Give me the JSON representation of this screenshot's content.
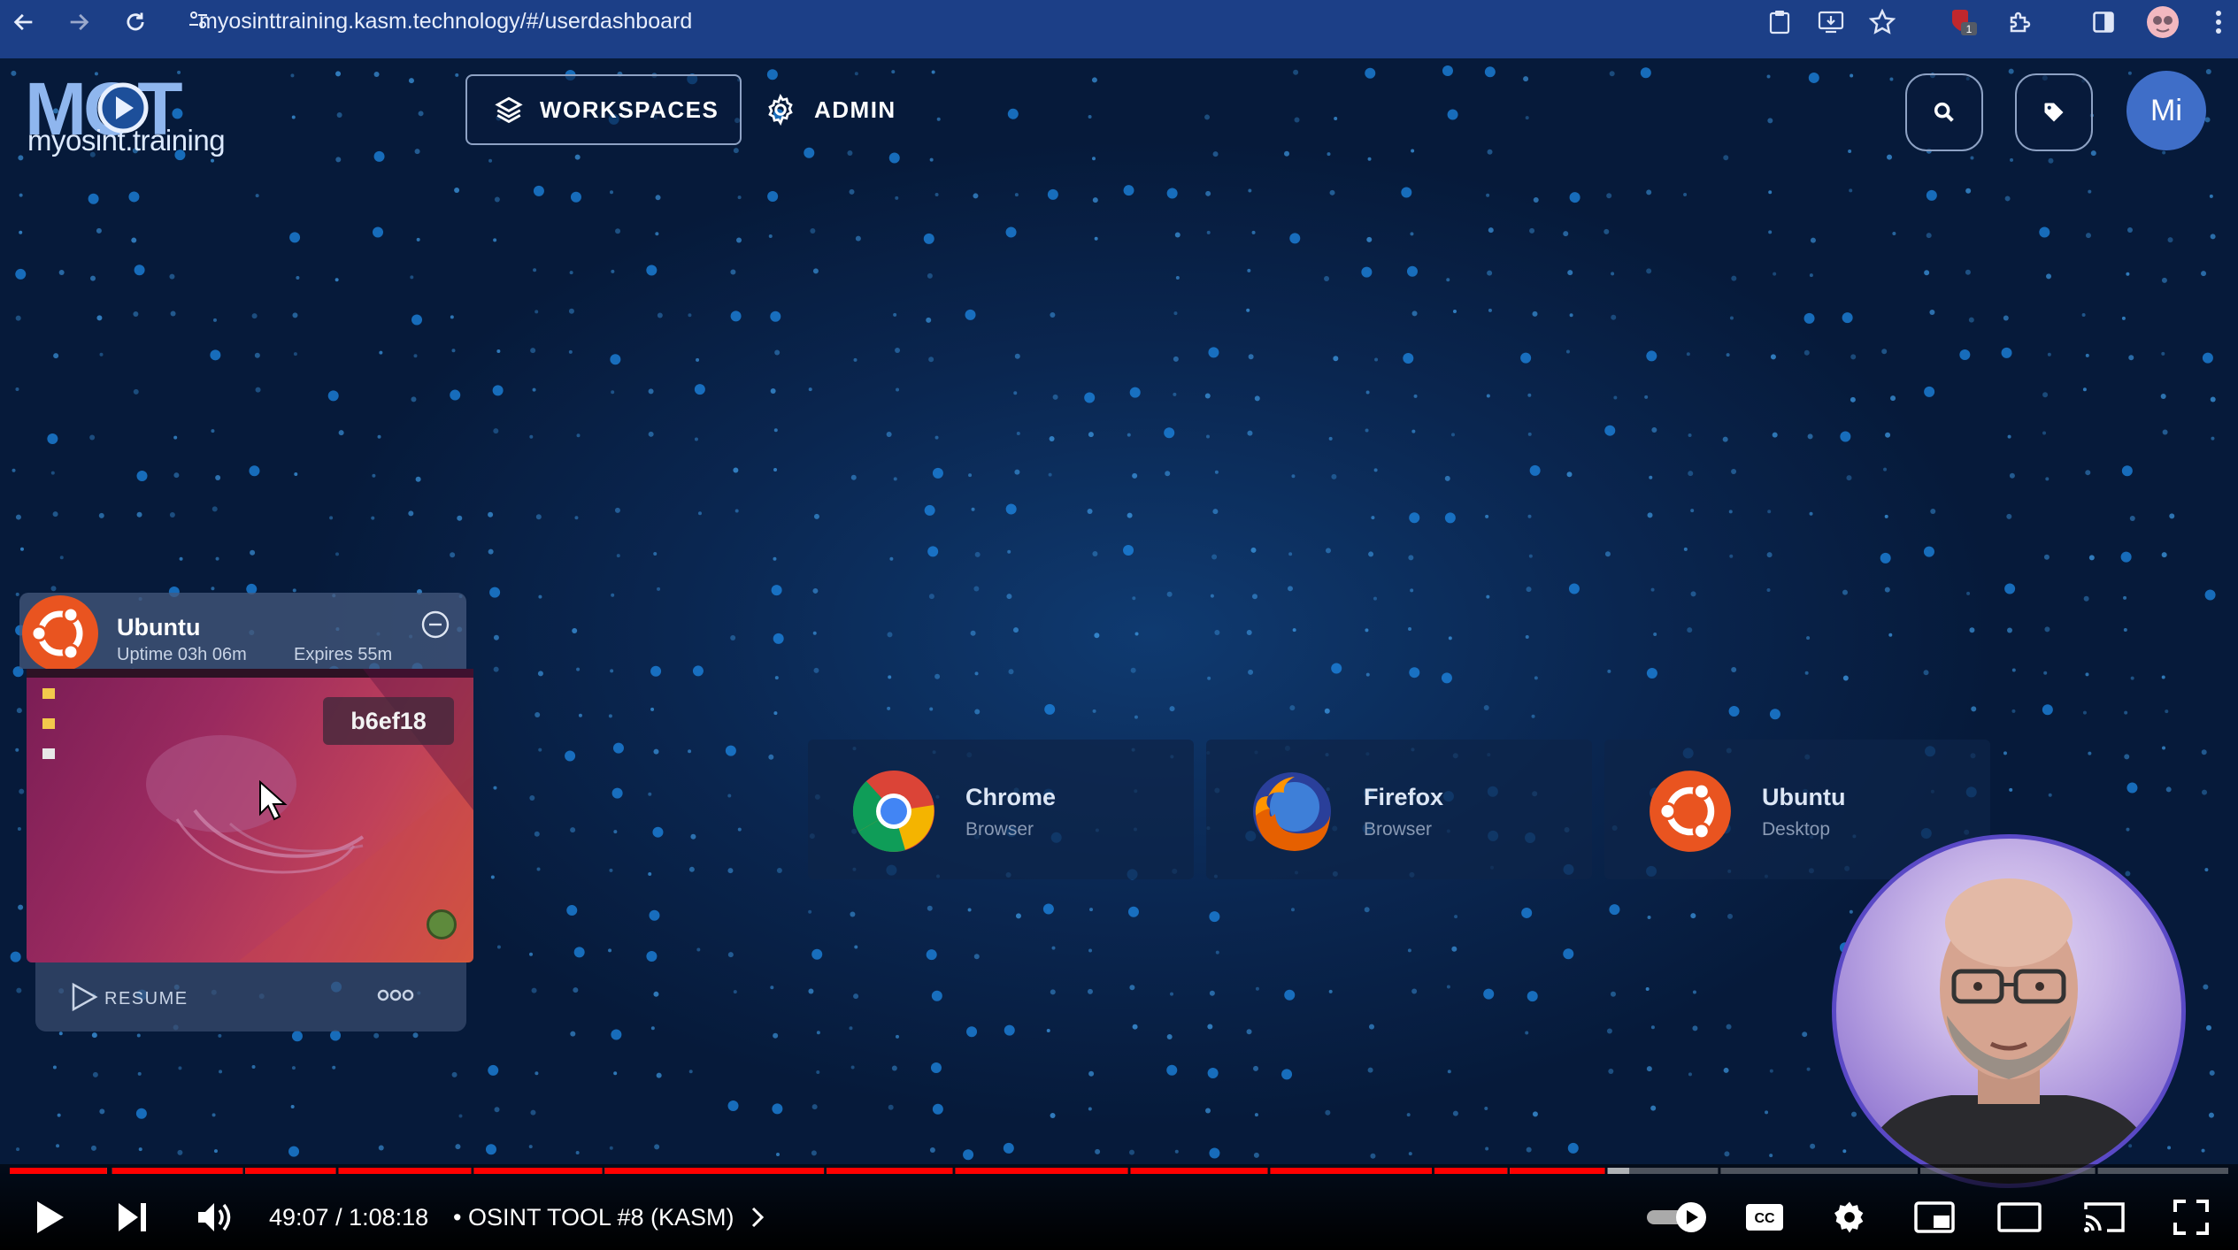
{
  "browser": {
    "url": "myosinttraining.kasm.technology/#/userdashboard",
    "icons": [
      "back-icon",
      "forward-icon",
      "reload-icon",
      "site-settings-icon",
      "clipboard-icon",
      "install-icon",
      "bookmark-star-icon",
      "extension-badge-icon",
      "extensions-puzzle-icon",
      "side-panel-icon",
      "profile-avatar-icon",
      "menu-kebab-icon"
    ],
    "extension_badge_count": "1"
  },
  "header": {
    "logo_text": "MOT",
    "logo_subtext": "myosint.training",
    "nav": {
      "workspaces_label": "WORKSPACES",
      "admin_label": "ADMIN"
    },
    "user_initials": "Mi"
  },
  "session": {
    "name": "Ubuntu",
    "uptime": "Uptime 03h 06m",
    "expires": "Expires 55m",
    "id": "b6ef18",
    "resume_label": "RESUME"
  },
  "workspaces": [
    {
      "name": "Chrome",
      "desc": "Browser",
      "icon": "chrome-icon"
    },
    {
      "name": "Firefox",
      "desc": "Browser",
      "icon": "firefox-icon"
    },
    {
      "name": "Ubuntu",
      "desc": "Desktop",
      "icon": "ubuntu-icon"
    }
  ],
  "player": {
    "time": "49:07 / 1:08:18",
    "chapter": "• OSINT TOOL #8 (KASM)",
    "progress_fraction": 0.719,
    "buffered_fraction": 0.73,
    "accent": "#ff0000"
  },
  "colors": {
    "browser_bar": "#1c3f87",
    "page_bg": "#061a3a",
    "ubuntu_orange": "#e95420",
    "avatar": "#3f6ec8"
  }
}
